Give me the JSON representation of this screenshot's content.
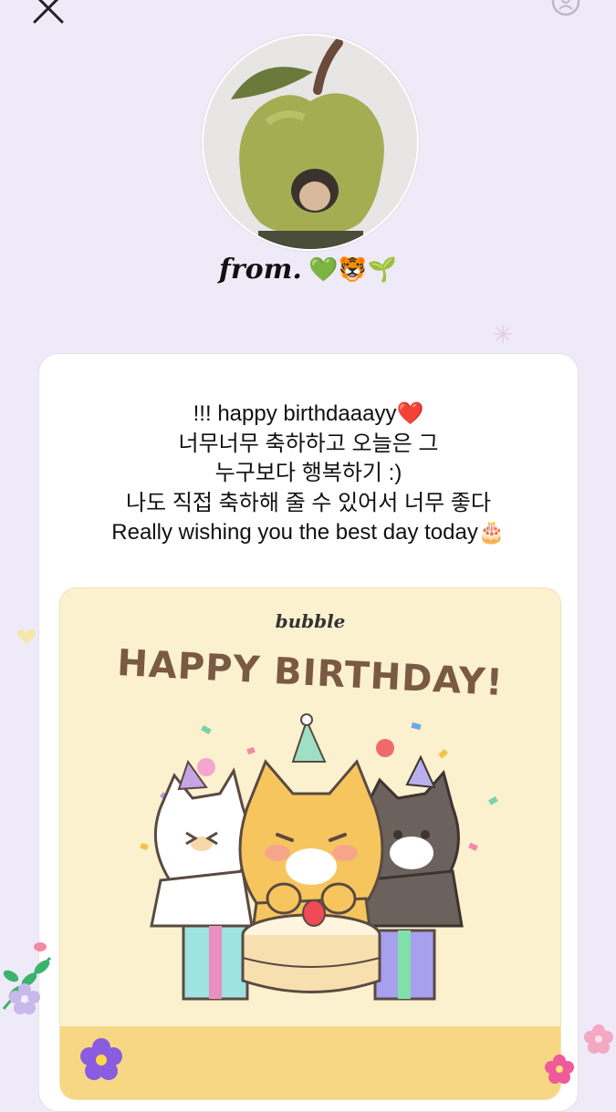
{
  "sender": {
    "from_label": "from.",
    "emojis": "💚🐯🌱"
  },
  "message": {
    "lines": [
      "!!! happy birthdaaayy❤️",
      "너무너무 축하하고 오늘은 그",
      "누구보다 행복하기 :)",
      "나도 직접 축하해 줄 수 있어서 너무 좋다",
      "Really wishing you the best day today🎂"
    ]
  },
  "card": {
    "brand": "bubble",
    "headline": "HAPPY BIRTHDAY!"
  },
  "colors": {
    "background": "#efeaf8",
    "card_bg": "#ffffff",
    "birthday_bg": "#fbf1cf",
    "headline": "#7a5a44",
    "band": "#f8d784"
  },
  "icons": [
    "close-icon",
    "refresh-icon",
    "apple-avatar",
    "flower-icon",
    "heart-icon",
    "sparkle-icon"
  ]
}
